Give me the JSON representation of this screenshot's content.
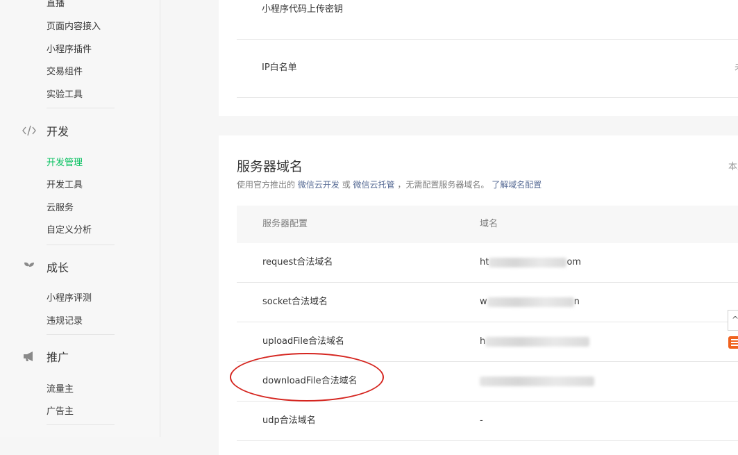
{
  "sidebar": {
    "top_items": [
      "直播",
      "页面内容接入",
      "小程序插件",
      "交易组件",
      "实验工具"
    ],
    "groups": [
      {
        "icon": "code-icon",
        "label": "开发",
        "items": [
          "开发管理",
          "开发工具",
          "云服务",
          "自定义分析"
        ],
        "active_index": 0
      },
      {
        "icon": "sprout-icon",
        "label": "成长",
        "items": [
          "小程序评测",
          "违规记录"
        ]
      },
      {
        "icon": "megaphone-icon",
        "label": "推广",
        "items": [
          "流量主",
          "广告主"
        ]
      }
    ]
  },
  "top_card": {
    "rows": [
      {
        "label": "小程序代码上传密钥",
        "value": ""
      },
      {
        "label": "IP白名单",
        "value": "未"
      }
    ]
  },
  "server_domain": {
    "title": "服务器域名",
    "right_text": "本月",
    "desc_prefix": "使用官方推出的",
    "desc_link1": "微信云开发",
    "desc_or": "或",
    "desc_link2": "微信云托管",
    "desc_middle": "，无需配置服务器域名。",
    "desc_link3": "了解域名配置",
    "table": {
      "headers": [
        "服务器配置",
        "域名"
      ],
      "rows": [
        {
          "config": "request合法域名",
          "domain_start": "ht",
          "domain_end": "om"
        },
        {
          "config": "socket合法域名",
          "domain_start": "w",
          "domain_end": "n"
        },
        {
          "config": "uploadFile合法域名",
          "domain_start": "h",
          "domain_end": ""
        },
        {
          "config": "downloadFile合法域名",
          "domain_start": "",
          "domain_end": ""
        },
        {
          "config": "udp合法域名",
          "domain_start": "-",
          "domain_end": ""
        }
      ]
    }
  },
  "floating": {
    "tab_glyph": "^",
    "logo_icon": "s-logo-icon"
  },
  "colors": {
    "active": "#07c160",
    "link": "#576b95",
    "annotation": "#d5251f"
  }
}
